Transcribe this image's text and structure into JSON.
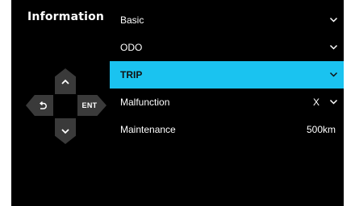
{
  "title": "Information",
  "dpad": {
    "up_icon": "chevron-up-icon",
    "down_icon": "chevron-down-icon",
    "left_icon": "back-arrow-icon",
    "enter_label": "ENT"
  },
  "colors": {
    "background": "#000000",
    "highlight": "#1ac3f0",
    "dpad_button": "#3a3a3a"
  },
  "menu": [
    {
      "label": "Basic",
      "value": "",
      "has_chevron": true,
      "selected": false
    },
    {
      "label": "ODO",
      "value": "",
      "has_chevron": true,
      "selected": false
    },
    {
      "label": "TRIP",
      "value": "",
      "has_chevron": true,
      "selected": true
    },
    {
      "label": "Malfunction",
      "value": "X",
      "has_chevron": true,
      "selected": false
    },
    {
      "label": "Maintenance",
      "value": "500km",
      "has_chevron": false,
      "selected": false
    }
  ]
}
